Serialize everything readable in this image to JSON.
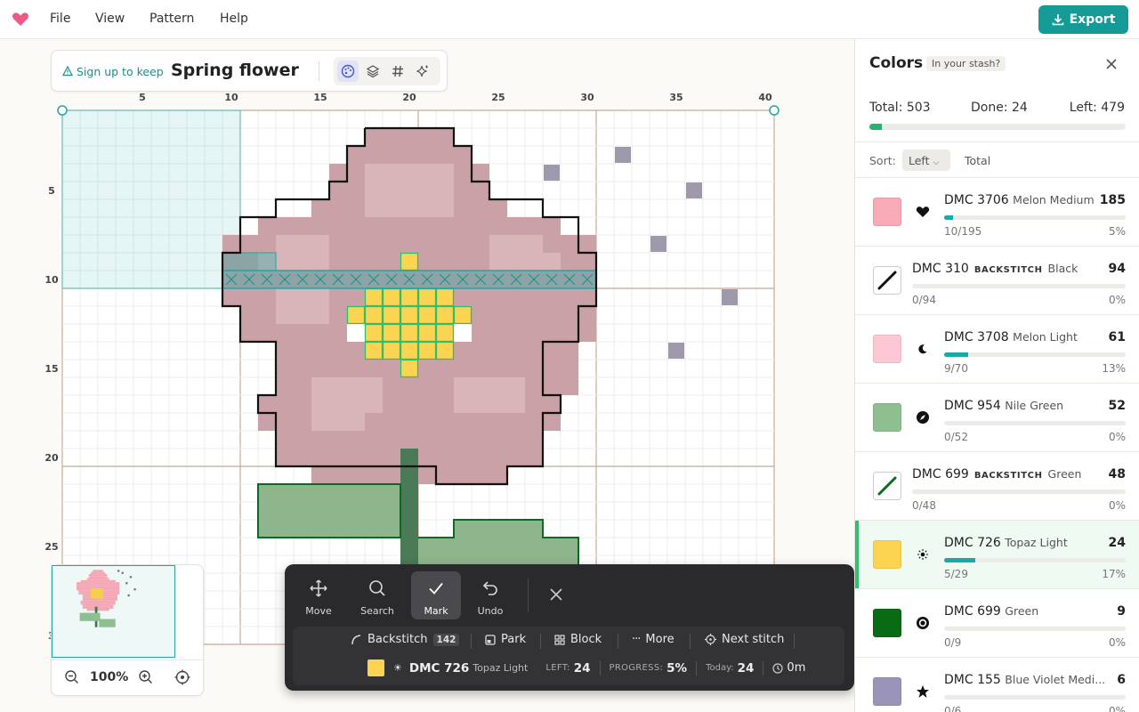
{
  "menu": {
    "file": "File",
    "view": "View",
    "pattern": "Pattern",
    "help": "Help"
  },
  "export_label": "Export",
  "pattern": {
    "signup": "Sign up to keep",
    "title": "Spring flower"
  },
  "grid": {
    "top_ticks": [
      "5",
      "10",
      "15",
      "20",
      "25",
      "30",
      "35",
      "40"
    ],
    "left_ticks": [
      "5",
      "10",
      "15",
      "20",
      "25",
      "3"
    ]
  },
  "colors_panel": {
    "title": "Colors",
    "stash": "In your stash?",
    "total": "Total: 503",
    "done": "Done: 24",
    "left": "Left: 479",
    "progress": 0.05,
    "sort_label": "Sort:",
    "sort_left": "Left",
    "sort_total": "Total",
    "rows": [
      {
        "code": "DMC 3706",
        "name": "Melon Medium",
        "count": "185",
        "frac": "10/195",
        "pct": "5%",
        "progress": 0.05,
        "color": "#f9aab7",
        "symbol": "heart-icon"
      },
      {
        "code": "DMC 310",
        "tag": "BACKSTITCH",
        "name": "Black",
        "count": "94",
        "frac": "0/94",
        "pct": "0%",
        "progress": 0,
        "color": "#111111",
        "symbol": "backstitch-line"
      },
      {
        "code": "DMC 3708",
        "name": "Melon Light",
        "count": "61",
        "frac": "9/70",
        "pct": "13%",
        "progress": 0.13,
        "color": "#fdc8d3",
        "symbol": "moon-icon"
      },
      {
        "code": "DMC 954",
        "name": "Nile Green",
        "count": "52",
        "frac": "0/52",
        "pct": "0%",
        "progress": 0,
        "color": "#8fbf90",
        "symbol": "compass-icon"
      },
      {
        "code": "DMC 699",
        "tag": "BACKSTITCH",
        "name": "Green",
        "count": "48",
        "frac": "0/48",
        "pct": "0%",
        "progress": 0,
        "color": "#0b6a24",
        "symbol": "backstitch-line"
      },
      {
        "code": "DMC 726",
        "name": "Topaz Light",
        "count": "24",
        "frac": "5/29",
        "pct": "17%",
        "progress": 0.17,
        "color": "#fdd452",
        "symbol": "sun-icon"
      },
      {
        "code": "DMC 699",
        "name": "Green",
        "count": "9",
        "frac": "0/9",
        "pct": "0%",
        "progress": 0,
        "color": "#0b6a14",
        "symbol": "target-icon"
      },
      {
        "code": "DMC 155",
        "name": "Blue Violet Medi...",
        "count": "6",
        "frac": "0/6",
        "pct": "0%",
        "progress": 0,
        "color": "#9a95b8",
        "symbol": "star-icon"
      }
    ]
  },
  "zoom": "100%",
  "tools": {
    "move": "Move",
    "search": "Search",
    "mark": "Mark",
    "undo": "Undo"
  },
  "actions": {
    "backstitch": "Backstitch",
    "backstitch_count": "142",
    "park": "Park",
    "block": "Block",
    "more": "More",
    "next": "Next stitch"
  },
  "status": {
    "color_code": "DMC 726",
    "color_name": "Topaz Light",
    "left_label": "LEFT:",
    "left_value": "24",
    "progress_label": "PROGRESS:",
    "progress_value": "5%",
    "today_label": "Today:",
    "today_value": "24",
    "time": "0m"
  }
}
